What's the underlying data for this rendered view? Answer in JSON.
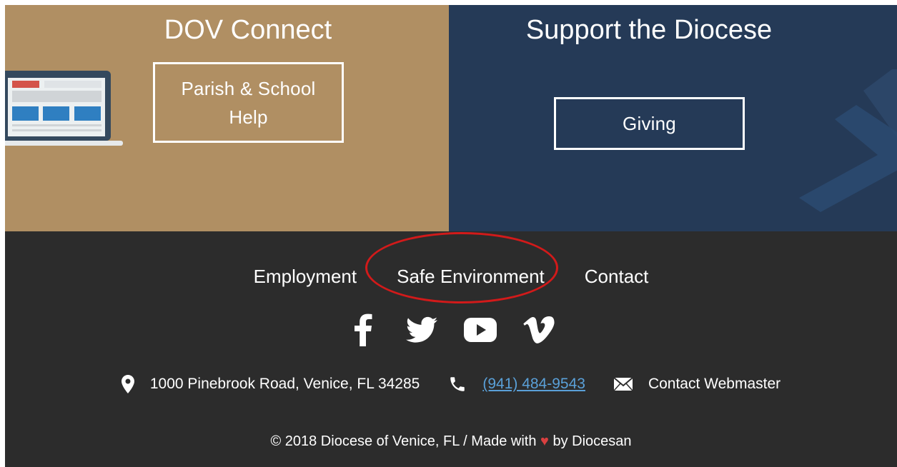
{
  "panels": {
    "left": {
      "title": "DOV Connect",
      "button_label": "Parish & School Help",
      "bg": "#b08f63"
    },
    "right": {
      "title": "Support the Diocese",
      "button_label": "Giving",
      "bg": "#253a57"
    }
  },
  "footer": {
    "nav": [
      {
        "label": "Employment"
      },
      {
        "label": "Safe Environment"
      },
      {
        "label": "Contact"
      }
    ],
    "social": [
      {
        "icon": "facebook-icon"
      },
      {
        "icon": "twitter-icon"
      },
      {
        "icon": "youtube-icon"
      },
      {
        "icon": "vimeo-icon"
      }
    ],
    "address": "1000 Pinebrook Road, Venice, FL 34285",
    "phone": "(941) 484-9543",
    "webmaster": "Contact Webmaster",
    "copyright_prefix": "© 2018 Diocese of Venice, FL / Made with",
    "heart": "♥",
    "copyright_suffix": "by Diocesan",
    "bg": "#2c2c2c",
    "link_color": "#5aa0d8",
    "highlight_color": "#d21a1a"
  }
}
